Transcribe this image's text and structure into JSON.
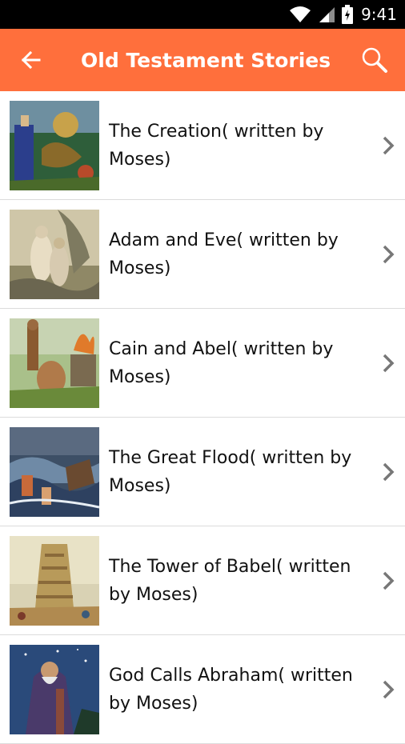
{
  "status_bar": {
    "time": "9:41",
    "icons": [
      "wifi-icon",
      "signal-icon",
      "battery-icon"
    ]
  },
  "app_bar": {
    "title": "Old Testament Stories",
    "background": "#FF6F3C",
    "back_icon": "arrow-back-icon",
    "search_icon": "search-icon"
  },
  "stories": [
    {
      "title": "The Creation( written by Moses)",
      "thumbnail": "creation-painting"
    },
    {
      "title": "Adam and Eve( written by Moses)",
      "thumbnail": "adam-eve-painting"
    },
    {
      "title": "Cain and Abel( written by Moses)",
      "thumbnail": "cain-abel-painting"
    },
    {
      "title": "The Great Flood( written by Moses)",
      "thumbnail": "flood-painting"
    },
    {
      "title": "The Tower of Babel( written by Moses)",
      "thumbnail": "babel-painting"
    },
    {
      "title": "God Calls Abraham( written by Moses)",
      "thumbnail": "abraham-painting"
    }
  ]
}
